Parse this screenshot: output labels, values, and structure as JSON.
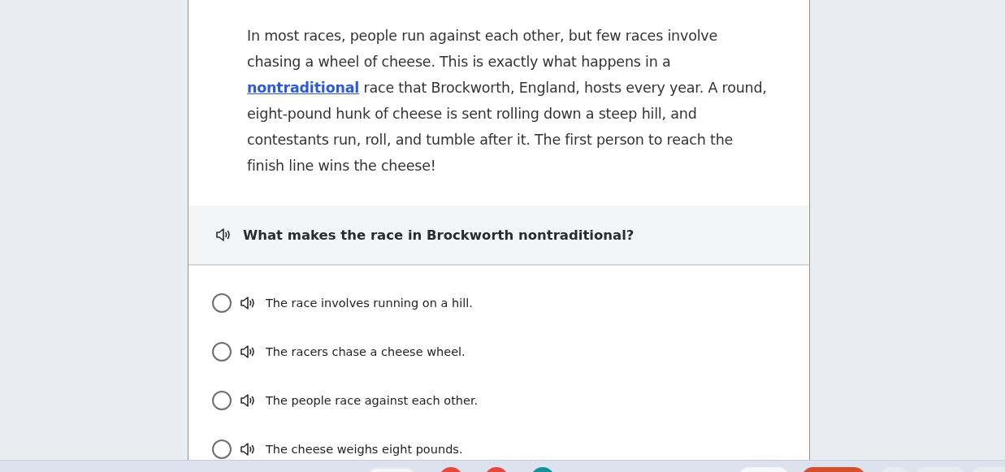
{
  "passage": {
    "before": "In most races, people run against each other, but few races involve chasing a wheel of cheese. This is exactly what happens in a",
    "link": "nontraditional",
    "after": "race that Brockworth, England, hosts every year. A round, eight-pound hunk of cheese is sent rolling down a steep hill, and contestants run, roll, and tumble after it. The first person to reach the finish line wins the cheese!"
  },
  "question": {
    "text": "What makes the race in Brockworth nontraditional?"
  },
  "options": [
    {
      "text": "The race involves running on a hill.",
      "selected": false
    },
    {
      "text": "The racers chase a cheese wheel.",
      "selected": false
    },
    {
      "text": "The people race against each other.",
      "selected": false
    },
    {
      "text": "The cheese weighs eight pounds.",
      "selected": false
    }
  ]
}
